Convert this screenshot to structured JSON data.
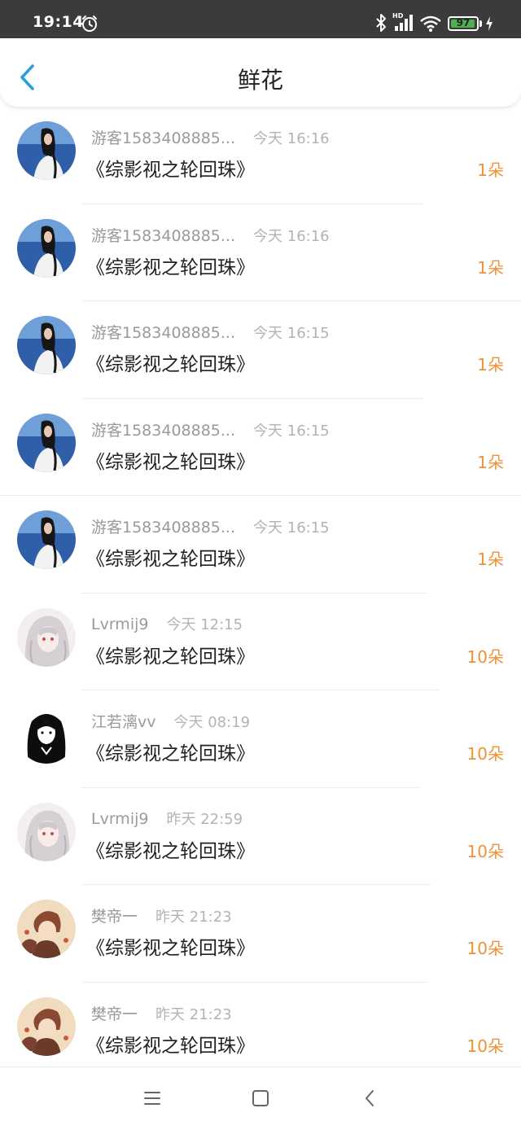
{
  "status_bar": {
    "time": "19:14",
    "battery": "97",
    "battery_level": 0.97,
    "hd": "HD",
    "icons": [
      "alarm-icon",
      "bluetooth-icon",
      "signal-icon",
      "wifi-icon",
      "battery-icon",
      "charging-icon"
    ]
  },
  "header": {
    "title": "鲜花",
    "back_icon": "chevron-left-icon",
    "accent": "#2a9fe0"
  },
  "colors": {
    "flower_count": "#f0913a",
    "meta_text": "#999999",
    "status_bar_bg": "#3b3b3b"
  },
  "list": [
    {
      "avatar": "photo-girl-sea",
      "user": "游客1583408885...",
      "time": "今天 16:16",
      "book": "《综影视之轮回珠》",
      "count": "1朵"
    },
    {
      "avatar": "photo-girl-sea",
      "user": "游客1583408885...",
      "time": "今天 16:16",
      "book": "《综影视之轮回珠》",
      "count": "1朵"
    },
    {
      "avatar": "photo-girl-sea",
      "user": "游客1583408885...",
      "time": "今天 16:15",
      "book": "《综影视之轮回珠》",
      "count": "1朵"
    },
    {
      "avatar": "photo-girl-sea",
      "user": "游客1583408885...",
      "time": "今天 16:15",
      "book": "《综影视之轮回珠》",
      "count": "1朵"
    },
    {
      "avatar": "photo-girl-sea",
      "user": "游客1583408885...",
      "time": "今天 16:15",
      "book": "《综影视之轮回珠》",
      "count": "1朵"
    },
    {
      "avatar": "anime-girl-white-hair",
      "user": "Lvrmij9",
      "time": "今天 12:15",
      "book": "《综影视之轮回珠》",
      "count": "10朵"
    },
    {
      "avatar": "anime-girl-black-silhouette",
      "user": "江若漓vv",
      "time": "今天 08:19",
      "book": "《综影视之轮回珠》",
      "count": "10朵"
    },
    {
      "avatar": "anime-girl-white-hair",
      "user": "Lvrmij9",
      "time": "昨天 22:59",
      "book": "《综影视之轮回珠》",
      "count": "10朵"
    },
    {
      "avatar": "anime-boys-brown",
      "user": "樊帝一",
      "time": "昨天 21:23",
      "book": "《综影视之轮回珠》",
      "count": "10朵"
    },
    {
      "avatar": "anime-boys-brown",
      "user": "樊帝一",
      "time": "昨天 21:23",
      "book": "《综影视之轮回珠》",
      "count": "10朵"
    }
  ],
  "nav_bar": {
    "icons": [
      "menu-icon",
      "home-square-icon",
      "back-triangle-icon"
    ]
  }
}
